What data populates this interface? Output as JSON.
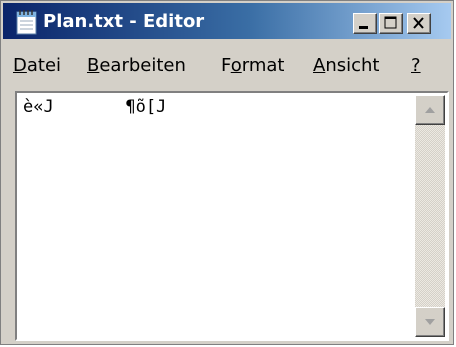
{
  "window": {
    "title": "Plan.txt - Editor",
    "icon": "notepad-icon",
    "caption_buttons": [
      "minimize-icon",
      "maximize-icon",
      "close-icon"
    ]
  },
  "menu": {
    "items": [
      {
        "label": "Datei",
        "accel_char": "D"
      },
      {
        "label": "Bearbeiten",
        "accel_char": "B"
      },
      {
        "label": "Format",
        "accel_char": "o"
      },
      {
        "label": "Ansicht",
        "accel_char": "A"
      },
      {
        "label": "?",
        "accel_char": "?"
      }
    ]
  },
  "document": {
    "content": "è«J       ¶õ[J"
  },
  "colors": {
    "titlebar_start": "#0a246a",
    "titlebar_end": "#a6caf0",
    "chrome": "#d4d0c8"
  }
}
